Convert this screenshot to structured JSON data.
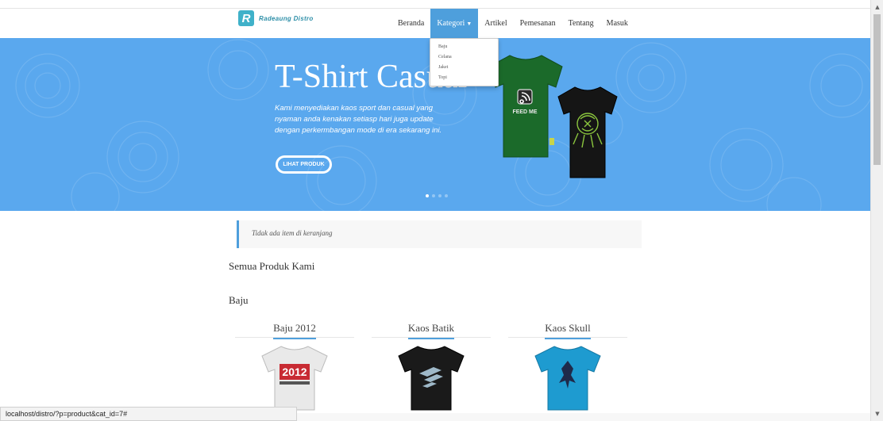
{
  "brand": {
    "logo_letter": "R",
    "name": "Radeaung Distro"
  },
  "nav": {
    "items": [
      {
        "label": "Beranda"
      },
      {
        "label": "Kategori"
      },
      {
        "label": "Artikel"
      },
      {
        "label": "Pemesanan"
      },
      {
        "label": "Tentang"
      },
      {
        "label": "Masuk"
      }
    ],
    "active": "Kategori"
  },
  "dropdown": {
    "items": [
      "Baju",
      "Celana",
      "Jaket",
      "Topi"
    ]
  },
  "hero": {
    "title": "T-Shirt Casual",
    "subtitle": "Kami menyediakan kaos sport dan casual yang nyaman anda kenakan setiasp hari juga update dengan perkermbangan mode di era sekarang ini.",
    "button": "LIHAT PRODUK",
    "shirt_text": "FEED ME",
    "slides": 4,
    "active_slide": 1
  },
  "cart": {
    "message": "Tidak ada item di keranjang"
  },
  "sections": {
    "all_products": "Semua Produk Kami",
    "category": "Baju"
  },
  "products": [
    {
      "title": "Baju 2012",
      "print": "2012"
    },
    {
      "title": "Kaos Batik"
    },
    {
      "title": "Kaos Skull"
    }
  ],
  "status": {
    "url": "localhost/distro/?p=product&cat_id=7#"
  },
  "colors": {
    "accent": "#4e9fdc",
    "hero_bg": "#5aa8ee",
    "logo": "#3fb1c9"
  }
}
